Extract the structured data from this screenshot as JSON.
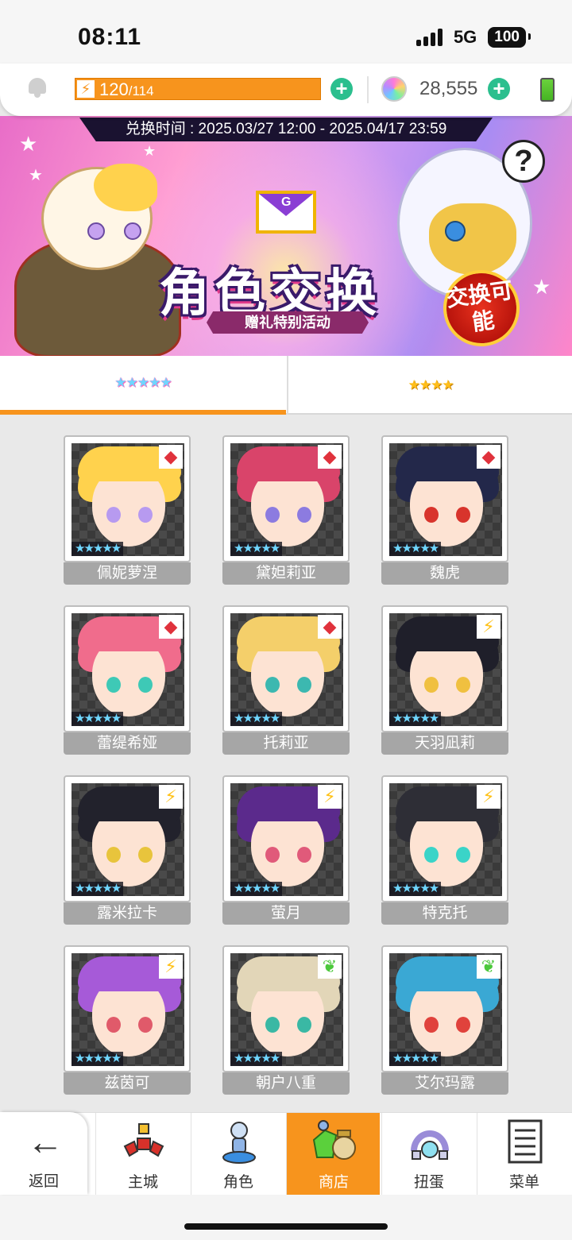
{
  "status_bar": {
    "time": "08:11",
    "network": "5G",
    "battery": "100"
  },
  "resources": {
    "energy_current": "120",
    "energy_max": "/114",
    "gems": "28,555",
    "energy_icon": "lightning-icon",
    "gem_icon": "rainbow-gem-icon"
  },
  "banner": {
    "period": "兑换时间 : 2025.03/27 12:00 - 2025.04/17 23:59",
    "title": "角色交换",
    "subtitle": "赠礼特别活动",
    "badge": "交换可能",
    "help": "?"
  },
  "tabs": [
    {
      "label": "★★★★★",
      "active": true
    },
    {
      "label": "★★★★",
      "active": false
    }
  ],
  "characters": [
    {
      "name": "佩妮萝涅",
      "stars": "★★★★★",
      "element": "fire",
      "element_glyph": "◆",
      "hair": "#ffd24d",
      "eye": "#b79af0"
    },
    {
      "name": "黛妲莉亚",
      "stars": "★★★★★",
      "element": "fire",
      "element_glyph": "◆",
      "hair": "#d9446a",
      "eye": "#8c7be0"
    },
    {
      "name": "魏虎",
      "stars": "★★★★★",
      "element": "fire",
      "element_glyph": "◆",
      "hair": "#23284a",
      "eye": "#d8342c"
    },
    {
      "name": "蕾缇希娅",
      "stars": "★★★★★",
      "element": "fire",
      "element_glyph": "◆",
      "hair": "#f06c8c",
      "eye": "#3ec9b6"
    },
    {
      "name": "托莉亚",
      "stars": "★★★★★",
      "element": "fire",
      "element_glyph": "◆",
      "hair": "#f4cf6a",
      "eye": "#3cb8b0"
    },
    {
      "name": "天羽凪莉",
      "stars": "★★★★★",
      "element": "thunder",
      "element_glyph": "⚡",
      "hair": "#1f1f2a",
      "eye": "#f0c040"
    },
    {
      "name": "露米拉卡",
      "stars": "★★★★★",
      "element": "thunder",
      "element_glyph": "⚡",
      "hair": "#22222c",
      "eye": "#e8c43c"
    },
    {
      "name": "萤月",
      "stars": "★★★★★",
      "element": "thunder",
      "element_glyph": "⚡",
      "hair": "#5b2a8c",
      "eye": "#e05a7a"
    },
    {
      "name": "特克托",
      "stars": "★★★★★",
      "element": "thunder",
      "element_glyph": "⚡",
      "hair": "#2e2e36",
      "eye": "#3ad4c8"
    },
    {
      "name": "兹茵可",
      "stars": "★★★★★",
      "element": "thunder",
      "element_glyph": "⚡",
      "hair": "#a65ad8",
      "eye": "#e05a6a"
    },
    {
      "name": "朝户八重",
      "stars": "★★★★★",
      "element": "wind",
      "element_glyph": "❦",
      "hair": "#e2d6b8",
      "eye": "#3ab8a4"
    },
    {
      "name": "艾尔玛露",
      "stars": "★★★★★",
      "element": "wind",
      "element_glyph": "❦",
      "hair": "#3aa8d4",
      "eye": "#e0423c"
    }
  ],
  "bottom_nav": {
    "back": "返回",
    "items": [
      {
        "label": "主城",
        "icon": "castle-icon"
      },
      {
        "label": "角色",
        "icon": "character-icon"
      },
      {
        "label": "商店",
        "icon": "shop-icon",
        "active": true
      },
      {
        "label": "扭蛋",
        "icon": "gacha-icon"
      },
      {
        "label": "菜单",
        "icon": "menu-icon"
      }
    ]
  },
  "colors": {
    "accent": "#f7941d",
    "plus_button": "#2bbf8e",
    "fire_element": "#e0323c",
    "thunder_element": "#ffc21a",
    "wind_element": "#4cc83c"
  }
}
